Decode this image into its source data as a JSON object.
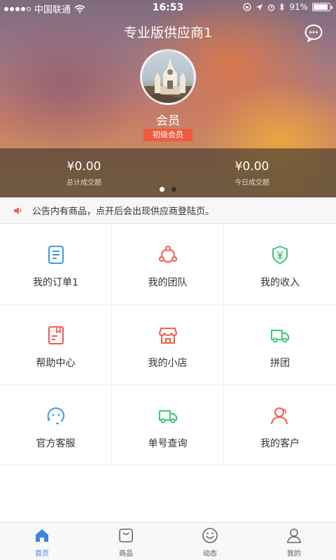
{
  "status_bar": {
    "carrier": "中国联通",
    "time": "16:53",
    "battery": "91%",
    "battery_level": 0.91
  },
  "header": {
    "title": "专业版供应商1",
    "username": "会员",
    "level": "初级会员"
  },
  "stats": [
    {
      "value": "¥0.00",
      "label": "总计成交额"
    },
    {
      "value": "¥0.00",
      "label": "今日成交额"
    }
  ],
  "notice": {
    "text": "公告内有商品，点开后会出现供应商登陆页。"
  },
  "grid": [
    {
      "label": "我的订单1",
      "icon": "document-icon",
      "color": "#3a9be8"
    },
    {
      "label": "我的团队",
      "icon": "team-icon",
      "color": "#f05a4e"
    },
    {
      "label": "我的收入",
      "icon": "income-shield-icon",
      "color": "#3fc77a"
    },
    {
      "label": "帮助中心",
      "icon": "help-book-icon",
      "color": "#f05a4e"
    },
    {
      "label": "我的小店",
      "icon": "shop-icon",
      "color": "#f05a4e"
    },
    {
      "label": "拼团",
      "icon": "truck-icon",
      "color": "#3fc77a"
    },
    {
      "label": "官方客服",
      "icon": "service-chat-icon",
      "color": "#3a9be8"
    },
    {
      "label": "单号查询",
      "icon": "delivery-truck-icon",
      "color": "#3fc77a"
    },
    {
      "label": "我的客户",
      "icon": "customers-icon",
      "color": "#f05a4e"
    }
  ],
  "tabs": [
    {
      "label": "首页",
      "icon": "home-icon",
      "active": true
    },
    {
      "label": "商品",
      "icon": "bag-icon",
      "active": false
    },
    {
      "label": "动态",
      "icon": "smile-icon",
      "active": false
    },
    {
      "label": "我的",
      "icon": "person-icon",
      "active": false
    }
  ],
  "colors": {
    "accent": "#3b84e0",
    "badge": "#f05a3e"
  }
}
